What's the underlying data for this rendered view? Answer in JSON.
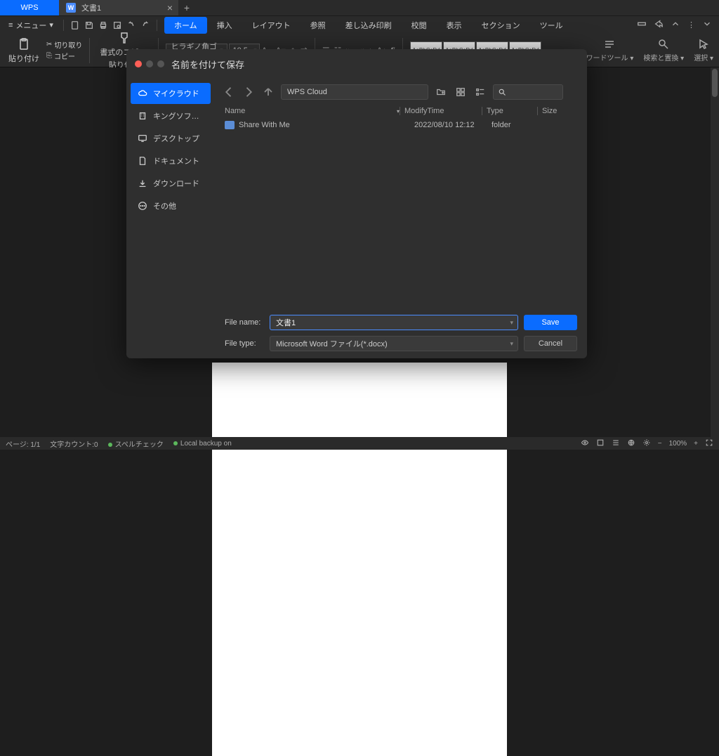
{
  "titlebar": {
    "app_tab": "WPS",
    "doc_tab": "文書1",
    "doc_icon_letter": "W"
  },
  "menubar": {
    "menu_label": "メニュー",
    "tabs": [
      "ホーム",
      "挿入",
      "レイアウト",
      "参照",
      "差し込み印刷",
      "校閲",
      "表示",
      "セクション",
      "ツール"
    ],
    "active_tab_index": 0
  },
  "ribbon": {
    "paste_label": "貼り付け",
    "cut_label": "切り取り",
    "copy_label": "コピー",
    "format_painter_top": "書式のコピー/",
    "format_painter_bottom": "貼り付け",
    "font_name": "ヒラギノ角ゴ Pro",
    "font_size": "10.5",
    "style_sample": "AaBbCcDd",
    "word_tools": "ワードツール",
    "find_replace": "検索と置換",
    "select_label": "選択"
  },
  "dialog": {
    "title": "名前を付けて保存",
    "locations": [
      {
        "label": "マイクラウド",
        "icon": "cloud"
      },
      {
        "label": "キングソフト株式...",
        "icon": "building"
      },
      {
        "label": "デスクトップ",
        "icon": "desktop"
      },
      {
        "label": "ドキュメント",
        "icon": "document"
      },
      {
        "label": "ダウンロード",
        "icon": "download"
      },
      {
        "label": "その他",
        "icon": "more"
      }
    ],
    "active_location_index": 0,
    "path": "WPS Cloud",
    "columns": {
      "name": "Name",
      "modify": "ModifyTime",
      "type": "Type",
      "size": "Size"
    },
    "rows": [
      {
        "name": "Share With Me",
        "modify": "2022/08/10 12:12",
        "type": "folder",
        "size": ""
      }
    ],
    "filename_label": "File name:",
    "filename_value": "文書1",
    "filetype_label": "File type:",
    "filetype_value": "Microsoft Word ファイル(*.docx)",
    "save_label": "Save",
    "cancel_label": "Cancel"
  },
  "statusbar": {
    "page": "ページ: 1/1",
    "chars": "文字カウント:0",
    "spell": "スペルチェック",
    "backup": "Local backup on",
    "zoom": "100%"
  }
}
